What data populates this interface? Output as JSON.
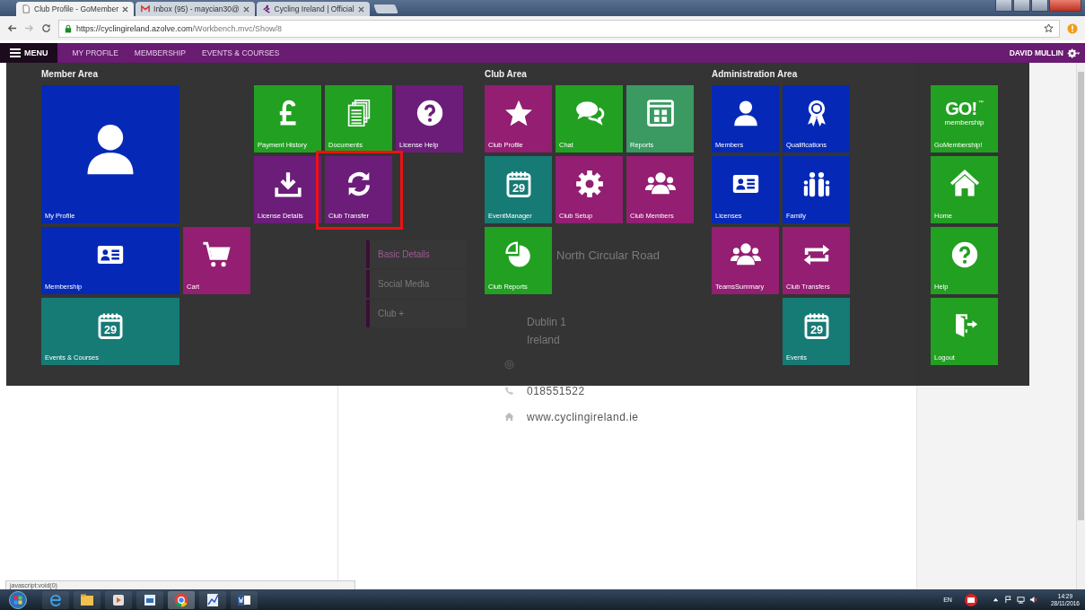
{
  "browser": {
    "tabs": [
      {
        "title": "Club Profile - GoMember",
        "kind": "page",
        "selected": true
      },
      {
        "title": "Inbox (95) - maycian30@",
        "kind": "mail",
        "selected": false
      },
      {
        "title": "Cycling Ireland | Official",
        "kind": "site",
        "selected": false
      }
    ],
    "url_host": "https://cyclingireland.azolve.com",
    "url_path": "/Workbench.mvc/Show/8"
  },
  "nav": {
    "menu": "MENU",
    "links": [
      "MY PROFILE",
      "MEMBERSHIP",
      "EVENTS & COURSES"
    ],
    "user": "DAVID MULLIN"
  },
  "menu_sections": [
    {
      "title": "Member Area",
      "tiles": [
        {
          "label": "My Profile",
          "kind": "person",
          "color": "#0529b6",
          "highlighted": false
        },
        {
          "label": "Payment History",
          "kind": "pound",
          "color": "#22a022",
          "highlighted": false
        },
        {
          "label": "Documents",
          "kind": "documents",
          "color": "#22a022",
          "highlighted": false
        },
        {
          "label": "License Help",
          "kind": "question",
          "color": "#6c1d7a",
          "highlighted": false
        },
        {
          "label": "License Details",
          "kind": "download",
          "color": "#6c1d7a",
          "highlighted": false
        },
        {
          "label": "Club Transfer",
          "kind": "refresh",
          "color": "#6c1d7a",
          "highlighted": true
        },
        {
          "label": "Membership",
          "kind": "idcard",
          "color": "#0529b6",
          "highlighted": false
        },
        {
          "label": "Cart",
          "kind": "cart",
          "color": "#931e72",
          "highlighted": false
        },
        {
          "label": "Events & Courses",
          "kind": "calendar",
          "icon_text": "29",
          "color": "#167a75",
          "highlighted": false
        }
      ]
    },
    {
      "title": "Club Area",
      "tiles": [
        {
          "label": "Club Profile",
          "kind": "star",
          "color": "#931e72",
          "highlighted": false
        },
        {
          "label": "Chat",
          "kind": "chat",
          "color": "#22a022",
          "highlighted": false
        },
        {
          "label": "Reports",
          "kind": "dashboard",
          "color": "#3a9a62",
          "highlighted": false
        },
        {
          "label": "EventManager",
          "kind": "calendar",
          "icon_text": "29",
          "color": "#167a75",
          "highlighted": false
        },
        {
          "label": "Club Setup",
          "kind": "gear",
          "color": "#931e72",
          "highlighted": false
        },
        {
          "label": "Club Members",
          "kind": "group",
          "color": "#931e72",
          "highlighted": false
        },
        {
          "label": "Club Reports",
          "kind": "pie",
          "color": "#22a022",
          "highlighted": false
        }
      ]
    },
    {
      "title": "Administration Area",
      "tiles": [
        {
          "label": "Members",
          "kind": "person",
          "color": "#0529b6",
          "highlighted": false
        },
        {
          "label": "Qualifications",
          "kind": "medal",
          "color": "#0529b6",
          "highlighted": false
        },
        {
          "label": "Licenses",
          "kind": "idcard",
          "color": "#0529b6",
          "highlighted": false
        },
        {
          "label": "Family",
          "kind": "family",
          "color": "#0529b6",
          "highlighted": false
        },
        {
          "label": "TeamsSummary",
          "kind": "group",
          "color": "#931e72",
          "highlighted": false
        },
        {
          "label": "Club Transfers",
          "kind": "swap",
          "color": "#931e72",
          "highlighted": false
        },
        {
          "label": "Events",
          "kind": "calendar",
          "icon_text": "29",
          "color": "#167a75",
          "highlighted": false
        }
      ]
    },
    {
      "tiles": [
        {
          "label": "GoMembership!",
          "kind": "go-logo",
          "logo_text": "GO!",
          "logo_sub": "membership",
          "logo_mark": "™",
          "color": "#22a022",
          "highlighted": false
        },
        {
          "label": "Home",
          "kind": "home",
          "color": "#22a022",
          "highlighted": false
        },
        {
          "label": "Help",
          "kind": "question",
          "color": "#22a022",
          "highlighted": false
        },
        {
          "label": "Logout",
          "kind": "logout",
          "color": "#22a022",
          "highlighted": false
        }
      ]
    }
  ],
  "page": {
    "side_items": [
      "Basic Details",
      "Social Media",
      "Club +"
    ],
    "address_first": "North Circular Road",
    "address_rest": [
      "Dublin 1",
      "Ireland"
    ],
    "phone": "018551522",
    "website": "www.cyclingireland.ie"
  },
  "status_text": "javascript:void(0)",
  "taskbar": {
    "language": "EN",
    "time": "14:29",
    "date": "28/11/2016"
  }
}
